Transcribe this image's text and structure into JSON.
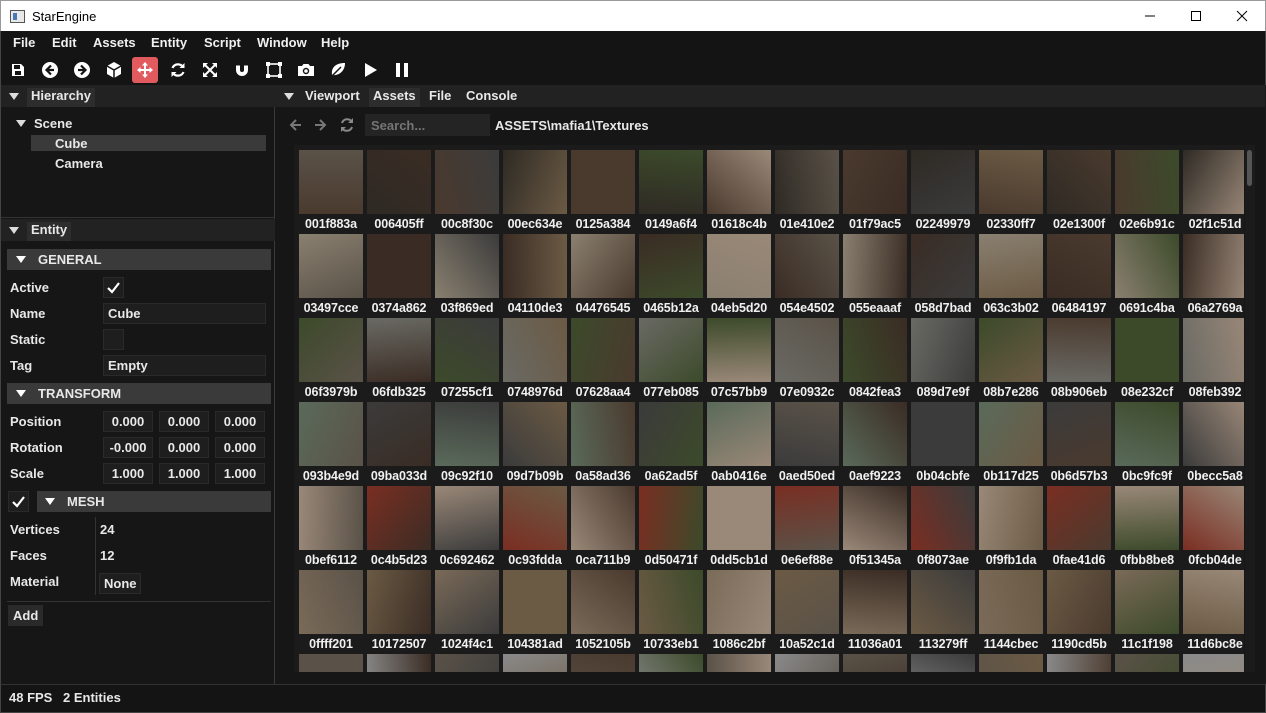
{
  "window": {
    "title": "StarEngine"
  },
  "menu": [
    "File",
    "Edit",
    "Assets",
    "Entity",
    "Script",
    "Window",
    "Help"
  ],
  "toolbar": {
    "icons": [
      "save-icon",
      "undo-icon",
      "redo-icon",
      "cube-icon",
      "move-icon",
      "rotate-icon",
      "scale-icon",
      "magnet-icon",
      "bounding-box-icon",
      "camera-icon",
      "leaf-icon",
      "play-icon",
      "pause-icon"
    ],
    "active": "move-icon",
    "accent": "#e05a5e"
  },
  "hierarchy": {
    "tab": "Hierarchy",
    "root": "Scene",
    "children": [
      "Cube",
      "Camera"
    ],
    "selected": "Cube"
  },
  "entity": {
    "tab": "Entity",
    "general": {
      "header": "GENERAL",
      "labels": {
        "active": "Active",
        "name": "Name",
        "static": "Static",
        "tag": "Tag"
      },
      "active": true,
      "name": "Cube",
      "static": false,
      "tag": "Empty"
    },
    "transform": {
      "header": "TRANSFORM",
      "labels": {
        "position": "Position",
        "rotation": "Rotation",
        "scale": "Scale"
      },
      "position": [
        "0.000",
        "0.000",
        "0.000"
      ],
      "rotation": [
        "-0.000",
        "0.000",
        "0.000"
      ],
      "scale": [
        "1.000",
        "1.000",
        "1.000"
      ]
    },
    "mesh": {
      "header": "MESH",
      "enabled": true,
      "labels": {
        "vertices": "Vertices",
        "faces": "Faces",
        "material": "Material"
      },
      "vertices": "24",
      "faces": "12",
      "material": "None"
    },
    "add_label": "Add"
  },
  "tabs": [
    "Viewport",
    "Assets",
    "File",
    "Console"
  ],
  "assets": {
    "search_placeholder": "Search...",
    "path": "ASSETS\\mafia1\\Textures",
    "items": [
      "001f883a",
      "006405ff",
      "00c8f30c",
      "00ec634e",
      "0125a384",
      "0149a6f4",
      "01618c4b",
      "01e410e2",
      "01f79ac5",
      "02249979",
      "02330ff7",
      "02e1300f",
      "02e6b91c",
      "02f1c51d",
      "03497cce",
      "0374a862",
      "03f869ed",
      "04110de3",
      "04476545",
      "0465b12a",
      "04eb5d20",
      "054e4502",
      "055eaaaf",
      "058d7bad",
      "063c3b02",
      "06484197",
      "0691c4ba",
      "06a2769a",
      "06f3979b",
      "06fdb325",
      "07255cf1",
      "0748976d",
      "07628aa4",
      "077eb085",
      "07c57bb9",
      "07e0932c",
      "0842fea3",
      "089d7e9f",
      "08b7e286",
      "08b906eb",
      "08e232cf",
      "08feb392",
      "093b4e9d",
      "09ba033d",
      "09c92f10",
      "09d7b09b",
      "0a58ad36",
      "0a62ad5f",
      "0ab0416e",
      "0aed50ed",
      "0aef9223",
      "0b04cbfe",
      "0b117d25",
      "0b6d57b3",
      "0bc9fc9f",
      "0becc5a8",
      "0bef6112",
      "0c4b5d23",
      "0c692462",
      "0c93fdda",
      "0ca711b9",
      "0d50471f",
      "0dd5cb1d",
      "0e6ef88e",
      "0f51345a",
      "0f8073ae",
      "0f9fb1da",
      "0fae41d6",
      "0fbb8be8",
      "0fcb04de",
      "0ffff201",
      "10172507",
      "1024f4c1",
      "104381ad",
      "1052105b",
      "10733eb1",
      "1086c2bf",
      "10a52c1d",
      "11036a01",
      "113279ff",
      "1144cbec",
      "1190cd5b",
      "11c1f198",
      "11d6bc8e"
    ]
  },
  "status": {
    "fps": "48 FPS",
    "entities": "2 Entities"
  }
}
